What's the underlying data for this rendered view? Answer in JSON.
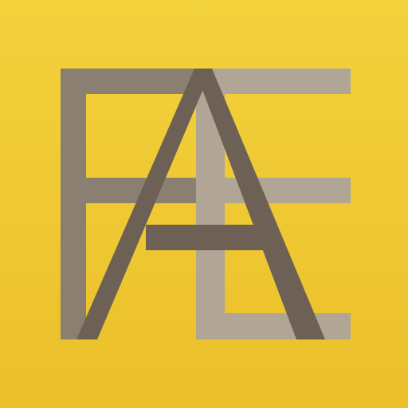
{
  "app_icon": {
    "logo_lettering": "FAE",
    "icon_name": "fae-monogram-icon",
    "colors": {
      "background_top": "#F3D23C",
      "background_bottom": "#EBBF2A",
      "letter_f": "#8B7F72",
      "letter_a": "#6D6055",
      "letter_e": "#B1A596"
    }
  }
}
